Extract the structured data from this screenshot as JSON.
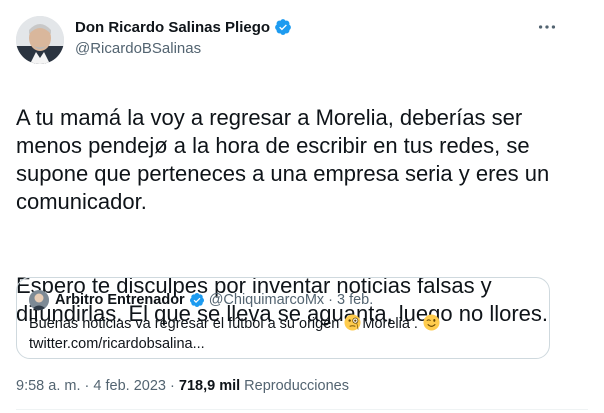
{
  "author": {
    "name": "Don Ricardo Salinas Pliego",
    "handle": "@RicardoBSalinas"
  },
  "tweet": {
    "paragraph_1": "A tu mamá la voy a regresar a Morelia, deberías ser menos pendejø a la hora de escribir en tus redes, se supone que perteneces a una empresa seria y eres un comunicador.",
    "paragraph_2": "Espero te disculpes por inventar noticias falsas y difundirlas. El que se lleva se aguanta, luego no llores."
  },
  "quoted_tweet": {
    "name": "Arbitro Entrenador",
    "handle": "@ChiquimarcoMx",
    "separator": "·",
    "date": "3 feb.",
    "text_before_emoji": "Buenas noticias va regresar el fútbol a su origen ",
    "text_after_emoji": "Morelia . ",
    "link": "twitter.com/ricardobsalina..."
  },
  "meta": {
    "time": "9:58 a. m.",
    "separator_1": "·",
    "date": "4 feb. 2023",
    "separator_2": "·",
    "views_count": "718,9 mil",
    "views_label": "Reproducciones"
  },
  "colors": {
    "verified_badge": "#1d9bf0",
    "secondary_text": "#536471",
    "primary_text": "#0f1419",
    "border": "#cfd9de"
  },
  "icons": {
    "verified": "verified-badge-icon",
    "more": "more-options-icon",
    "quote_emoji_1": "face-with-monocle-emoji",
    "quote_emoji_2": "winking-face-emoji"
  }
}
